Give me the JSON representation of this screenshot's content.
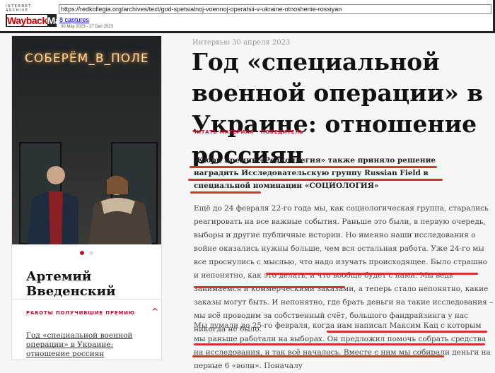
{
  "wayback": {
    "archive_label": "INTERNET ARCHIVE",
    "logo_text_a": "Wayback",
    "logo_text_b": "Machine",
    "url": "https://redkollegia.org/archives/text/god-spetsialnoj-voennoj-operatsii-v-ukraine-otnoshenie-rossiyan",
    "captures": "8 captures",
    "date_range": "30 May 2023 - 27 Dec 2023"
  },
  "sidebar": {
    "neon_sign": "СОБЕРЁМ_В_ПОЛЕ",
    "person_name": "Артемий Введенский",
    "awards_heading": "РАБОТЫ ПОЛУЧИВШИЕ ПРЕМИЮ",
    "award_work": "Год «специальной военной операции» в Украине: отношение россиян",
    "slides": 2,
    "active_slide": 1
  },
  "article": {
    "meta": "Интервью 30 апреля 2023",
    "title": "Год «специальной военной операции» в Украине: отношение россиян",
    "read_link": "ЧИТАТЬ МАТЕРИАЛ · ПОБЕДИТЕЛЬ",
    "lead": "Жюри премии «Редколлегия» также приняло решение наградить Исследовательскую группу Russian Field в специальной номинации «СОЦИОЛОГИЯ»",
    "p1": "Ещё до 24 февраля 22-го года мы, как социологическая группа, старались реагировать на все важные события. Раньше это были, в первую очередь, выборы и другие публичные истории. Но именно наши исследования о войне оказались нужны больше, чем вся остальная работа. Уже 24-го мы все проснулись с мыслью, что надо изучать происходящее. Было страшно и непонятно, как это делать, и что вообще будет с нами. Мы ведь занимаемся и коммерческими заказами, а теперь стало непонятно, какие заказы могут быть. И непонятно, где брать деньги на такие исследования –мы всё проводим за собственный счёт, большого фандрайзинга у нас никогда не было.",
    "p2": "Мы думали до 25-го февраля, когда нам написал Максим Кац с которым мы раньше работали на выборах. Он предложил помочь собрать средства на исследования, и так всё началось. Вместе с ним мы собирали деньги на первые 6 «волн». Поначалу"
  },
  "colors": {
    "accent": "#c8102e",
    "underline": "#d0342c"
  }
}
